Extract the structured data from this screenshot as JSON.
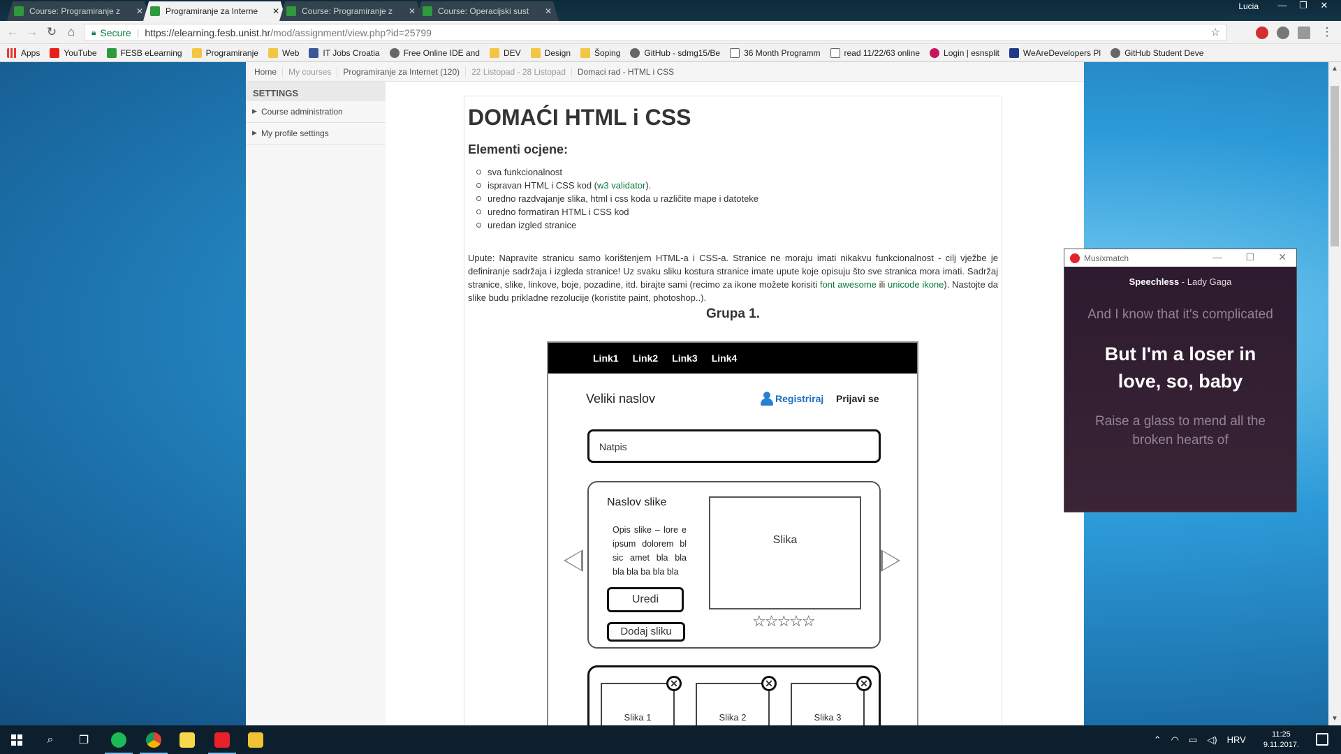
{
  "browser": {
    "user": "Lucia",
    "tabs": [
      {
        "title": "Course: Programiranje z",
        "active": false
      },
      {
        "title": "Programiranje za Interne",
        "active": true
      },
      {
        "title": "Course: Programiranje z",
        "active": false
      },
      {
        "title": "Course: Operacijski sust",
        "active": false
      }
    ],
    "secure_label": "Secure",
    "url_host": "https://elearning.fesb.unist.hr",
    "url_path": "/mod/assignment/view.php?id=25799",
    "bookmarks": [
      {
        "label": "Apps",
        "icon": "apps-grid-icon"
      },
      {
        "label": "YouTube",
        "icon": "youtube-icon"
      },
      {
        "label": "FESB eLearning",
        "icon": "moodle-icon"
      },
      {
        "label": "Programiranje",
        "icon": "folder-icon"
      },
      {
        "label": "Web",
        "icon": "folder-icon"
      },
      {
        "label": "IT Jobs Croatia",
        "icon": "facebook-icon"
      },
      {
        "label": "Free Online IDE and",
        "icon": "ide-icon"
      },
      {
        "label": "DEV",
        "icon": "folder-icon"
      },
      {
        "label": "Design",
        "icon": "folder-icon"
      },
      {
        "label": "Šoping",
        "icon": "folder-icon"
      },
      {
        "label": "GitHub - sdmg15/Be",
        "icon": "github-icon"
      },
      {
        "label": "36 Month Programm",
        "icon": "document-icon"
      },
      {
        "label": "read 11/22/63 online",
        "icon": "document-icon"
      },
      {
        "label": "Login | esnsplit",
        "icon": "esnsplit-icon"
      },
      {
        "label": "WeAreDevelopers Pl",
        "icon": "wearedevelopers-icon"
      },
      {
        "label": "GitHub Student Deve",
        "icon": "github-icon"
      }
    ]
  },
  "breadcrumb": [
    {
      "label": "Home",
      "dim": false
    },
    {
      "label": "My courses",
      "dim": true
    },
    {
      "label": "Programiranje za Internet (120)",
      "dim": false
    },
    {
      "label": "22 Listopad - 28 Listopad",
      "dim": true
    },
    {
      "label": "Domaci rad - HTML i CSS",
      "dim": false
    }
  ],
  "sidebar": {
    "heading": "SETTINGS",
    "items": [
      "Course administration",
      "My profile settings"
    ]
  },
  "content": {
    "title": "DOMAĆI HTML i CSS",
    "section": "Elementi ocjene:",
    "criteria": [
      {
        "before": "sva funkcionalnost",
        "link": "",
        "after": ""
      },
      {
        "before": "ispravan HTML i CSS kod (",
        "link": "w3 validator",
        "after": ")."
      },
      {
        "before": "uredno razdvajanje slika, html i css koda u različite mape i datoteke",
        "link": "",
        "after": ""
      },
      {
        "before": "uredno formatiran HTML i CSS kod",
        "link": "",
        "after": ""
      },
      {
        "before": "uredan izgled stranice",
        "link": "",
        "after": ""
      }
    ],
    "instructions_1": "Upute: Napravite stranicu samo korištenjem HTML-a i CSS-a. Stranice ne moraju imati nikakvu funkcionalnost - cilj vježbe je definiranje sadržaja i izgleda stranice! Uz svaku sliku kostura stranice imate upute koje opisuju što sve stranica mora imati. Sadržaj stranice, slike, linkove, boje, pozadine, itd. birajte sami (recimo za ikone možete korisiti ",
    "link_font_awesome": "font awesome",
    "instructions_or": " ili ",
    "link_unicode": "unicode ikone",
    "instructions_2": "). Nastojte da slike budu prikladne rezolucije (koristite paint, photoshop..).",
    "group_title": "Grupa 1."
  },
  "wireframe": {
    "nav_links": [
      "Link1",
      "Link2",
      "Link3",
      "Link4"
    ],
    "big_title": "Veliki naslov",
    "register": "Registriraj",
    "login": "Prijavi se",
    "caption": "Natpis",
    "image_title": "Naslov slike",
    "image_desc": "Opis slike – lore e ipsum dolorem bl sic amet bla bla bla bla ba bla bla",
    "edit_button": "Uredi",
    "add_button": "Dodaj sliku",
    "image_label": "Slika",
    "rating": "☆☆☆☆☆",
    "thumbs": [
      "Slika 1",
      "Slika 2",
      "Slika 3"
    ]
  },
  "musixmatch": {
    "app": "Musixmatch",
    "song": "Speechless",
    "artist": " - Lady Gaga",
    "prev_line": "And I know that it's complicated",
    "current_line": "But I'm a loser in love, so, baby",
    "next_line": "Raise a glass to mend all the broken hearts of"
  },
  "taskbar": {
    "language": "HRV",
    "time": "11:25",
    "date": "9.11.2017."
  },
  "colors": {
    "link_green": "#0a7a3a",
    "secure_green": "#0b8043",
    "musixmatch_red": "#e62129"
  }
}
